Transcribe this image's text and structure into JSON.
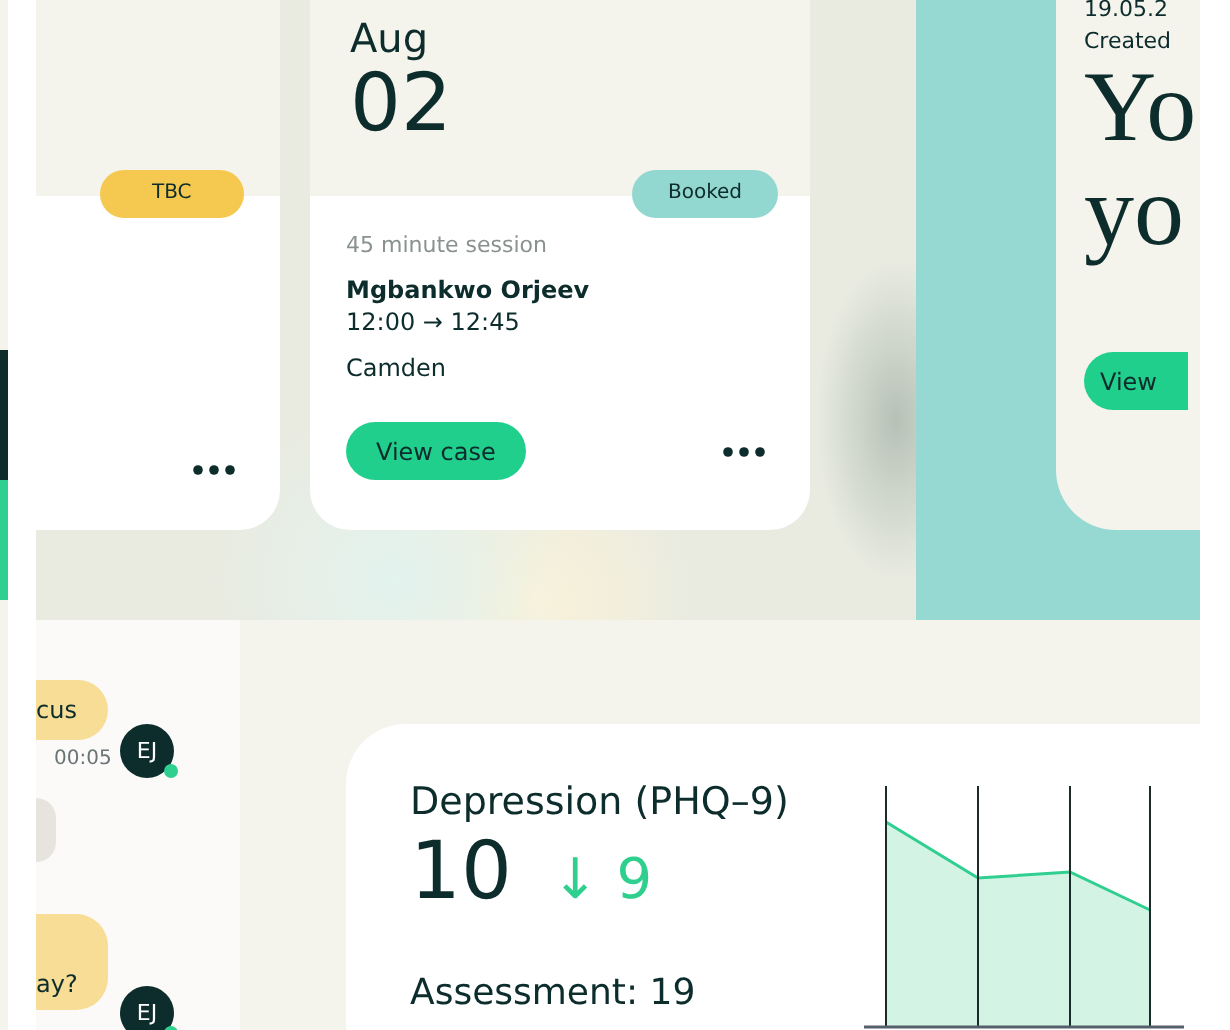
{
  "appointments": [
    {
      "kind": "pending",
      "status": {
        "label": "TBC",
        "color": "#f5c84f"
      }
    },
    {
      "kind": "booked",
      "status": {
        "label": "Booked",
        "color": "#93d7d1"
      },
      "month": "Aug",
      "day": "02",
      "session": "45 minute session",
      "client": "Mgbankwo Orjeev",
      "time": "12:00 → 12:45",
      "location": "Camden",
      "button": "View case"
    }
  ],
  "note_card": {
    "date": "19.05.2",
    "created": "Created",
    "heading_lines": [
      "Yo",
      "yo"
    ],
    "button": "View"
  },
  "chat": {
    "messages": [
      {
        "kind": "text",
        "text": "cus",
        "time": "00:05",
        "avatar": "EJ",
        "online": true
      },
      {
        "kind": "blank"
      },
      {
        "kind": "text",
        "text": "ay?",
        "avatar": "EJ",
        "online": true
      }
    ]
  },
  "score_card": {
    "title": "Depression (PHQ–9)",
    "score": "10",
    "change": "↓ 9",
    "assessment": "Assessment: 19"
  }
}
